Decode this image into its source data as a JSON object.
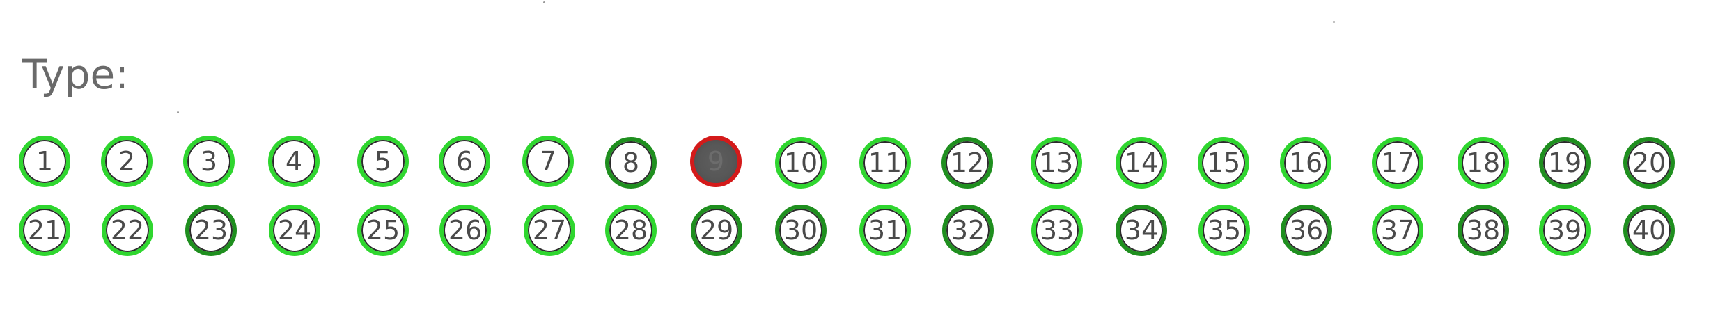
{
  "form": {
    "type_label": "Type:"
  },
  "options": [
    {
      "label": "1",
      "selected": false
    },
    {
      "label": "2",
      "selected": false
    },
    {
      "label": "3",
      "selected": false
    },
    {
      "label": "4",
      "selected": false
    },
    {
      "label": "5",
      "selected": false
    },
    {
      "label": "6",
      "selected": false
    },
    {
      "label": "7",
      "selected": false
    },
    {
      "label": "8",
      "selected": false
    },
    {
      "label": "9",
      "selected": true
    },
    {
      "label": "10",
      "selected": false
    },
    {
      "label": "11",
      "selected": false
    },
    {
      "label": "12",
      "selected": false
    },
    {
      "label": "13",
      "selected": false
    },
    {
      "label": "14",
      "selected": false
    },
    {
      "label": "15",
      "selected": false
    },
    {
      "label": "16",
      "selected": false
    },
    {
      "label": "17",
      "selected": false
    },
    {
      "label": "18",
      "selected": false
    },
    {
      "label": "19",
      "selected": false
    },
    {
      "label": "20",
      "selected": false
    },
    {
      "label": "21",
      "selected": false
    },
    {
      "label": "22",
      "selected": false
    },
    {
      "label": "23",
      "selected": false
    },
    {
      "label": "24",
      "selected": false
    },
    {
      "label": "25",
      "selected": false
    },
    {
      "label": "26",
      "selected": false
    },
    {
      "label": "27",
      "selected": false
    },
    {
      "label": "28",
      "selected": false
    },
    {
      "label": "29",
      "selected": false
    },
    {
      "label": "30",
      "selected": false
    },
    {
      "label": "31",
      "selected": false
    },
    {
      "label": "32",
      "selected": false
    },
    {
      "label": "33",
      "selected": false
    },
    {
      "label": "34",
      "selected": false
    },
    {
      "label": "35",
      "selected": false
    },
    {
      "label": "36",
      "selected": false
    },
    {
      "label": "37",
      "selected": false
    },
    {
      "label": "38",
      "selected": false
    },
    {
      "label": "39",
      "selected": false
    },
    {
      "label": "40",
      "selected": false
    }
  ],
  "colors": {
    "option_ring": "#2fd62f",
    "option_ring_dark": "#1f8f1f",
    "selected_ring": "#d41a1a",
    "selected_fill": "#575757",
    "label_text": "#6a6a6a",
    "number_text": "#4a4a4a"
  }
}
